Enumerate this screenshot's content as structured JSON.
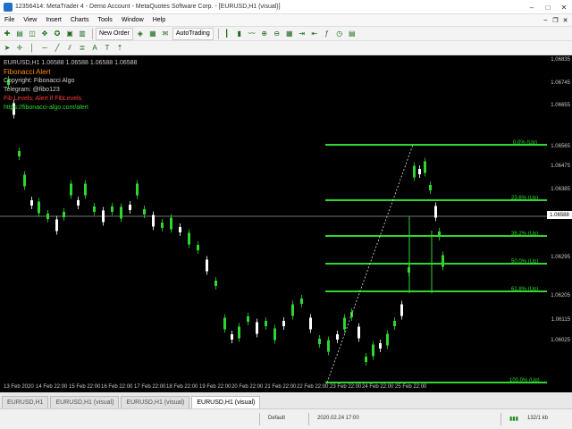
{
  "window": {
    "title": "12356414: MetaTrader 4 - Demo Account - MetaQuotes Software Corp. - [EURUSD,H1 (visual)]"
  },
  "menu": {
    "items": [
      "File",
      "View",
      "Insert",
      "Charts",
      "Tools",
      "Window",
      "Help"
    ]
  },
  "toolbar": {
    "new_order": "New Order",
    "autotrading": "AutoTrading"
  },
  "overlay": {
    "symbol_line": "EURUSD,H1  1.06588 1.06588 1.06588 1.06588",
    "title": "Fibonacci Alert",
    "copyright": "Copyright: Fibonacci Algo",
    "telegram": "Telegram: @fibo123",
    "red_line": "Fib Levels: Alert if FibLevels",
    "green_line": "https://fibonacci-algo.com/alert"
  },
  "fibo_labels": [
    "0.0%   (Up)",
    "23.6%   (Up)",
    "38.2%   (Up)",
    "50.0%   (Up)",
    "61.8%   (Up)",
    "100.0%   (Up)"
  ],
  "price_axis": [
    "1.06835",
    "1.06745",
    "1.06655",
    "1.06565",
    "1.06475",
    "1.06385",
    "1.06295",
    "1.06205",
    "1.06115",
    "1.06025"
  ],
  "current_price": "1.06588",
  "time_axis": [
    "13 Feb 2020",
    "14 Feb 22:00",
    "15 Feb 22:00",
    "16 Feb 22:00",
    "17 Feb 22:00",
    "18 Feb 22:00",
    "19 Feb 22:00",
    "20 Feb 22:00",
    "21 Feb 22:00",
    "22 Feb 22:00",
    "23 Feb 22:00",
    "24 Feb 22:00",
    "25 Feb 22:00"
  ],
  "tabs": [
    "EURUSD,H1",
    "EURUSD,H1 (visual)",
    "EURUSD,H1 (visual)",
    "EURUSD,H1 (visual)"
  ],
  "status": {
    "default": "Default",
    "date": "2020.02.24 17:00",
    "bars": "132/1 kb"
  },
  "colors": {
    "bull": "#2fd62f",
    "bear": "#ffffff",
    "fibo": "#2fd62f",
    "background": "#000000"
  }
}
